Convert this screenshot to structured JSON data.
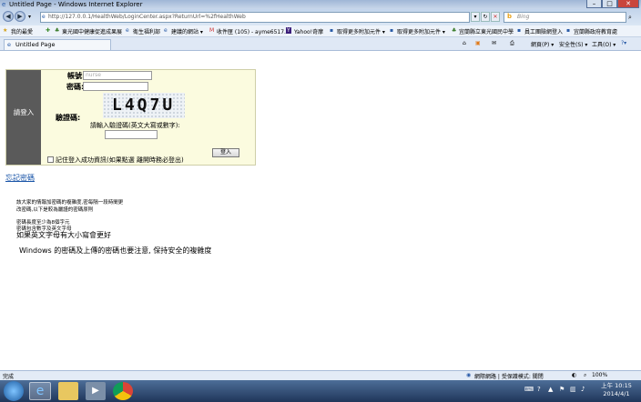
{
  "window": {
    "title": "Untitled Page - Windows Internet Explorer"
  },
  "address_bar": {
    "url": "http://127.0.0.1/HealthWeb/LoginCenter.aspx?ReturnUrl=%2fHealthWeb",
    "search_placeholder": "Bing"
  },
  "favorites": {
    "label": "我的最愛",
    "items": [
      "東光國中健康促進成果展",
      "衛生福利部",
      "建議的網站 ▾",
      "收件匣 (105) - ayme6517...",
      "Yahoo!奇摩",
      "取得更多附加元件 ▾",
      "取得更多附加元件 ▾",
      "宜蘭縣立東光國民中學",
      "員工團險網登入",
      "宜蘭縣政府教育處"
    ]
  },
  "tab": {
    "title": "Untitled Page"
  },
  "command_bar": {
    "items": [
      "網頁(P) ▾",
      "安全性(S) ▾",
      "工具(O) ▾"
    ]
  },
  "login": {
    "side_label": "請登入",
    "account_label": "帳號:",
    "account_placeholder": "nurse",
    "password_label": "密碼:",
    "captcha_label": "驗證碼:",
    "captcha_text": "L4Q7U",
    "captcha_hint": "請輸入驗證碼(英文大寫或數字):",
    "submit_label": "登入",
    "remember_label": "記住登入成功資訊(如果點選 離開時務必登出)"
  },
  "forgot_link": "忘記密碼",
  "notes": {
    "line1": "該大家的情報加密碼的複雜度,密每隔一段時間更",
    "line2": "改密碼,以下是較為嚴謹的密碼原則",
    "line3": "密碼長度至少為8個字元",
    "line4": "密碼包含數字及英文字母",
    "line5": "如果英文字母有大小寫會更好",
    "line6": "Windows 的密碼及上傳的密碼也要注意, 保持安全的複雜度"
  },
  "status": {
    "left": "完成",
    "zone": "網際網路 | 受保護模式: 關閉",
    "zoom": "100%"
  },
  "clock": {
    "time": "上午 10:15",
    "date": "2014/4/1"
  }
}
